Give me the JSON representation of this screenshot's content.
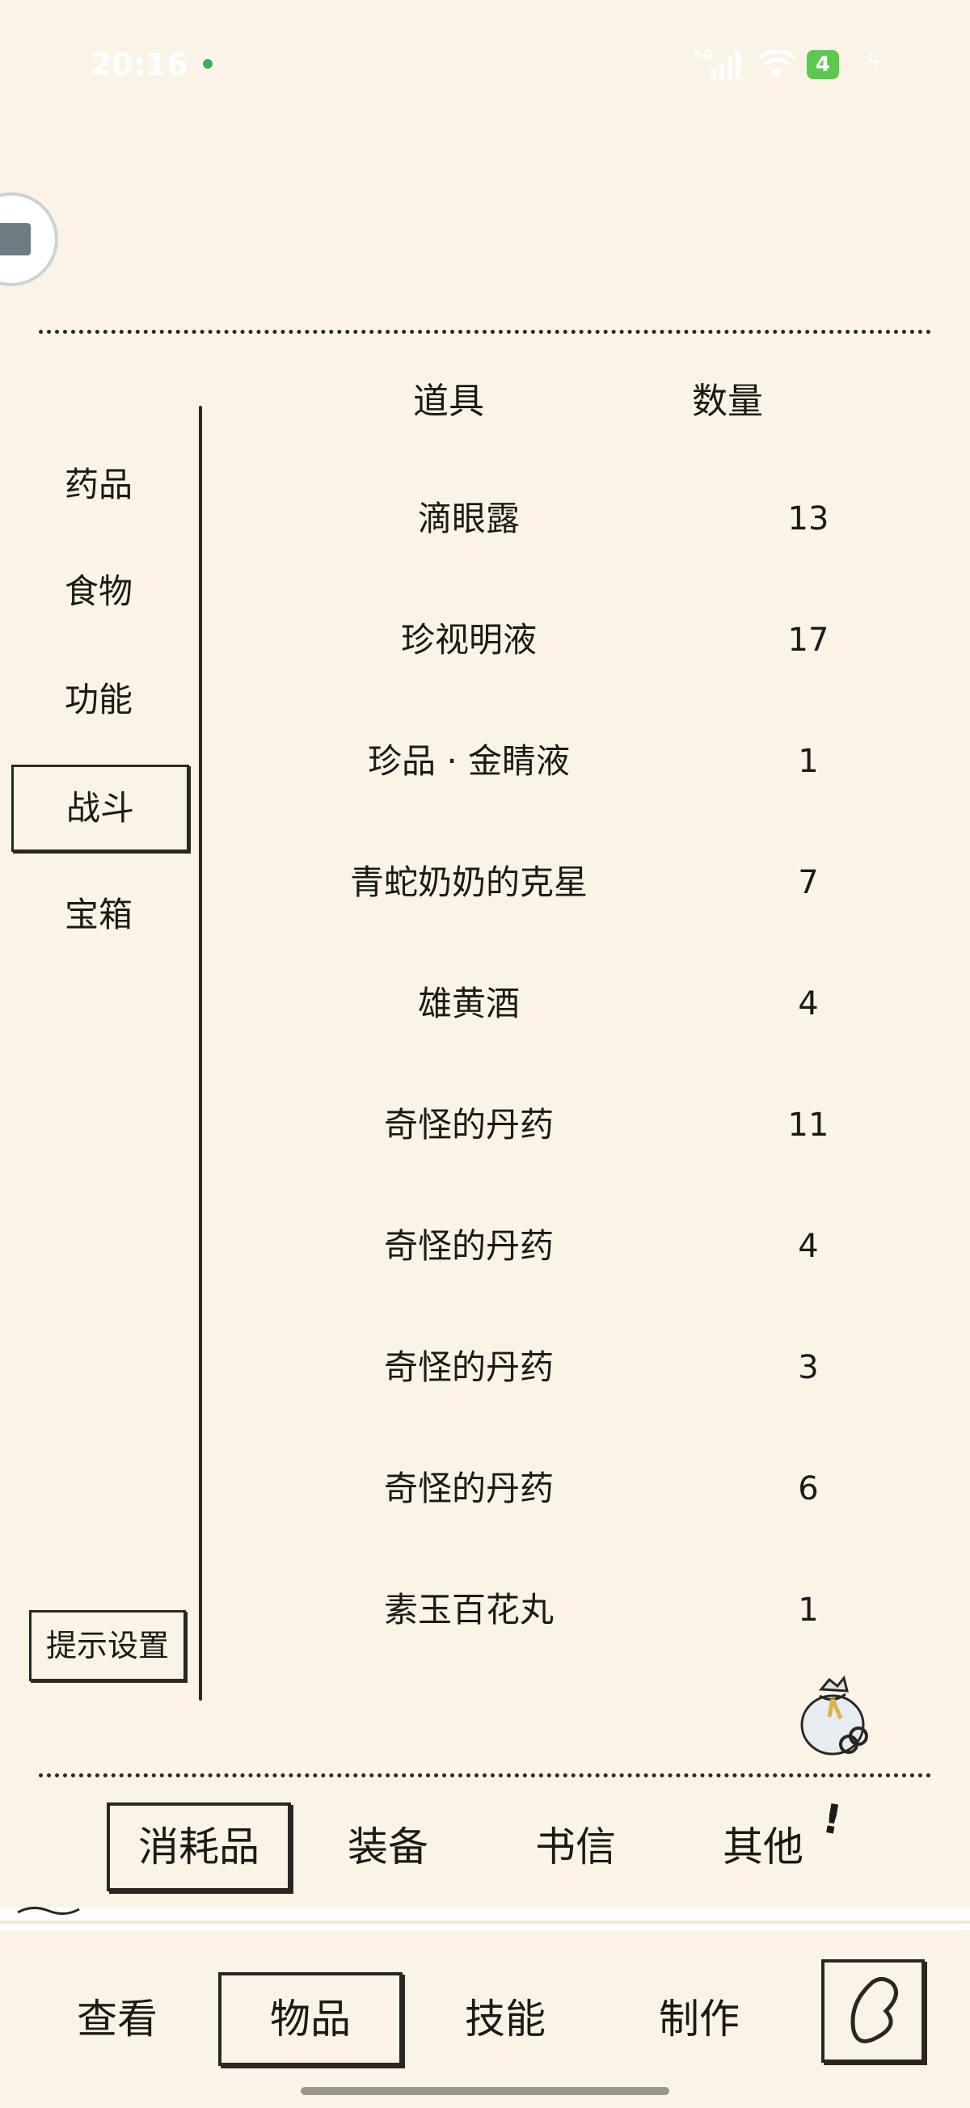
{
  "status_bar": {
    "time": "20:16",
    "network": "5G",
    "battery": "4"
  },
  "categories": [
    {
      "label": "药品",
      "active": false
    },
    {
      "label": "食物",
      "active": false
    },
    {
      "label": "功能",
      "active": false
    },
    {
      "label": "战斗",
      "active": true
    },
    {
      "label": "宝箱",
      "active": false
    }
  ],
  "hint_settings_label": "提示设置",
  "table": {
    "headers": {
      "name": "道具",
      "quantity": "数量"
    },
    "rows": [
      {
        "name": "滴眼露",
        "quantity": "13"
      },
      {
        "name": "珍视明液",
        "quantity": "17"
      },
      {
        "name": "珍品 · 金睛液",
        "quantity": "1"
      },
      {
        "name": "青蛇奶奶的克星",
        "quantity": "7"
      },
      {
        "name": "雄黄酒",
        "quantity": "4"
      },
      {
        "name": "奇怪的丹药",
        "quantity": "11"
      },
      {
        "name": "奇怪的丹药",
        "quantity": "4"
      },
      {
        "name": "奇怪的丹药",
        "quantity": "3"
      },
      {
        "name": "奇怪的丹药",
        "quantity": "6"
      },
      {
        "name": "素玉百花丸",
        "quantity": "1"
      }
    ]
  },
  "sub_tabs": [
    {
      "label": "消耗品",
      "active": true
    },
    {
      "label": "装备",
      "active": false
    },
    {
      "label": "书信",
      "active": false
    },
    {
      "label": "其他",
      "active": false
    }
  ],
  "sub_tabs_alert": "!",
  "main_nav": [
    {
      "label": "查看",
      "active": false
    },
    {
      "label": "物品",
      "active": true
    },
    {
      "label": "技能",
      "active": false
    },
    {
      "label": "制作",
      "active": false
    }
  ],
  "icons": [
    "avatar-icon",
    "item-bag-icon",
    "back-heart-icon"
  ]
}
